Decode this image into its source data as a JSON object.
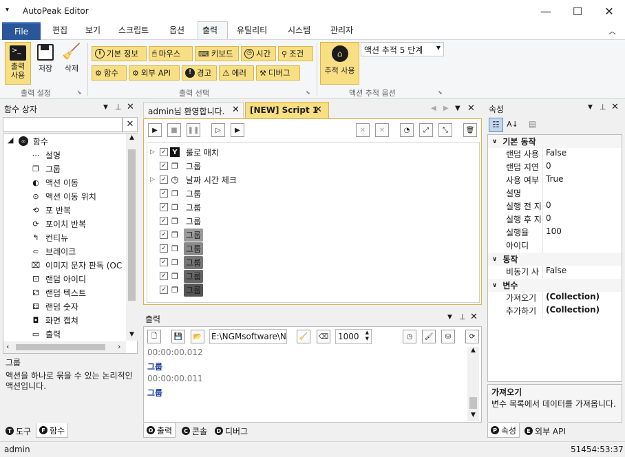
{
  "app": {
    "title": "AutoPeak Editor"
  },
  "menu": {
    "file": "File",
    "items": [
      "편집",
      "보기",
      "스크립트",
      "옵션",
      "출력",
      "유틸리티",
      "시스템",
      "관리자"
    ]
  },
  "ribbon": {
    "output_settings": {
      "buttons": [
        {
          "label1": "출력",
          "label2": "사용",
          "icon": "terminal-icon"
        },
        {
          "label": "저장",
          "icon": "save-icon"
        },
        {
          "label": "삭제",
          "icon": "broom-icon"
        }
      ],
      "group": "출력 설정"
    },
    "output_select": {
      "row1": [
        {
          "label": "기본 정보",
          "icon": "info-icon"
        },
        {
          "label": "마우스",
          "icon": "mouse-icon"
        },
        {
          "label": "키보드",
          "icon": "keyboard-icon"
        },
        {
          "label": "시간",
          "icon": "clock-icon"
        },
        {
          "label": "조건",
          "icon": "condition-icon"
        }
      ],
      "row2": [
        {
          "label": "함수",
          "icon": "function-icon"
        },
        {
          "label": "외부 API",
          "icon": "api-icon"
        },
        {
          "label": "경고",
          "icon": "warning-icon"
        },
        {
          "label": "에러",
          "icon": "error-icon"
        },
        {
          "label": "디버그",
          "icon": "debug-icon"
        }
      ],
      "group": "출력 선택"
    },
    "trace": {
      "button1": "추적 사용",
      "dropdown": "액션 추적 5 단계",
      "group": "액션 추적 옵션"
    }
  },
  "functions_panel": {
    "title": "함수 상자",
    "search": "",
    "root": "함수",
    "items": [
      {
        "label": "설명",
        "icon": "comment-icon"
      },
      {
        "label": "그룹",
        "icon": "group-icon"
      },
      {
        "label": "액션 이동",
        "icon": "goto-icon"
      },
      {
        "label": "액션 이동 위치",
        "icon": "target-icon"
      },
      {
        "label": "포 반복",
        "icon": "for-loop-icon"
      },
      {
        "label": "포이치 반복",
        "icon": "foreach-icon"
      },
      {
        "label": "컨티뉴",
        "icon": "continue-icon"
      },
      {
        "label": "브레이크",
        "icon": "break-icon"
      },
      {
        "label": "이미지 문자 판독 (OC",
        "icon": "ocr-icon"
      },
      {
        "label": "랜덤 아이디",
        "icon": "random-id-icon"
      },
      {
        "label": "랜덤 텍스트",
        "icon": "random-text-icon"
      },
      {
        "label": "랜덤 숫자",
        "icon": "random-number-icon"
      },
      {
        "label": "화면 캡쳐",
        "icon": "camera-icon"
      },
      {
        "label": "출력",
        "icon": "output-icon"
      }
    ],
    "desc_title": "그룹",
    "desc_text": "액션을 하나로 묶을 수 있는 논리적인 액션입니다.",
    "tabs": [
      "도구",
      "함수"
    ]
  },
  "editor": {
    "tabs": [
      "admin님 환영합니다.",
      "[NEW] Script 1"
    ],
    "rows": [
      {
        "label": "룰로 매치",
        "icon": "y-icon",
        "expand": true,
        "hl": ""
      },
      {
        "label": "그룹",
        "icon": "group-icon",
        "expand": false,
        "hl": ""
      },
      {
        "label": "날짜 시간 체크",
        "icon": "clock-icon",
        "expand": true,
        "hl": ""
      },
      {
        "label": "그룹",
        "icon": "group-icon",
        "expand": false,
        "hl": ""
      },
      {
        "label": "그룹",
        "icon": "group-icon",
        "expand": false,
        "hl": ""
      },
      {
        "label": "그룹",
        "icon": "group-icon",
        "expand": false,
        "hl": ""
      },
      {
        "label": "그룹",
        "icon": "group-icon",
        "expand": false,
        "hl": "#9c9c9c"
      },
      {
        "label": "그룹",
        "icon": "group-icon",
        "expand": false,
        "hl": "#8a8a8a"
      },
      {
        "label": "그룹",
        "icon": "group-icon",
        "expand": false,
        "hl": "#777777"
      },
      {
        "label": "그룹",
        "icon": "group-icon",
        "expand": false,
        "hl": "#666666"
      },
      {
        "label": "그룹",
        "icon": "group-icon",
        "expand": false,
        "hl": "#555555"
      }
    ]
  },
  "output_panel": {
    "title": "출력",
    "path": "E:\\NGMsoftware\\NG",
    "count": "1000",
    "lines": [
      {
        "text": "00:00:00.012",
        "kind": "time"
      },
      {
        "text": "그룹",
        "kind": "entry"
      },
      {
        "text": "00:00:00.011",
        "kind": "time"
      },
      {
        "text": "그룹",
        "kind": "entry"
      }
    ],
    "tabs": [
      "출력",
      "콘솔",
      "디버그"
    ]
  },
  "properties": {
    "title": "속성",
    "categories": [
      {
        "name": "기본 동작",
        "rows": [
          [
            "랜덤 사용",
            "False"
          ],
          [
            "랜덤 지연",
            "0"
          ],
          [
            "사용 여부",
            "True"
          ],
          [
            "설명",
            ""
          ],
          [
            "실행 전 지",
            "0"
          ],
          [
            "실행 후 지",
            "0"
          ],
          [
            "실행율",
            "100"
          ],
          [
            "아이디",
            ""
          ]
        ]
      },
      {
        "name": "동작",
        "rows": [
          [
            "비동기 사",
            "False"
          ]
        ]
      },
      {
        "name": "변수",
        "rows": [
          [
            "가져오기",
            "(Collection)"
          ],
          [
            "추가하기",
            "(Collection)"
          ]
        ]
      }
    ],
    "desc_title": "가져오기",
    "desc_text": "변수 목록에서 데이터를 가져옵니다.",
    "tabs": [
      "속성",
      "외부 API"
    ]
  },
  "status": {
    "user": "admin",
    "time": "51454:53:37"
  },
  "colors": {
    "accent": "#2b579a",
    "chip": "#f8df84",
    "link": "#1f3fa0"
  }
}
